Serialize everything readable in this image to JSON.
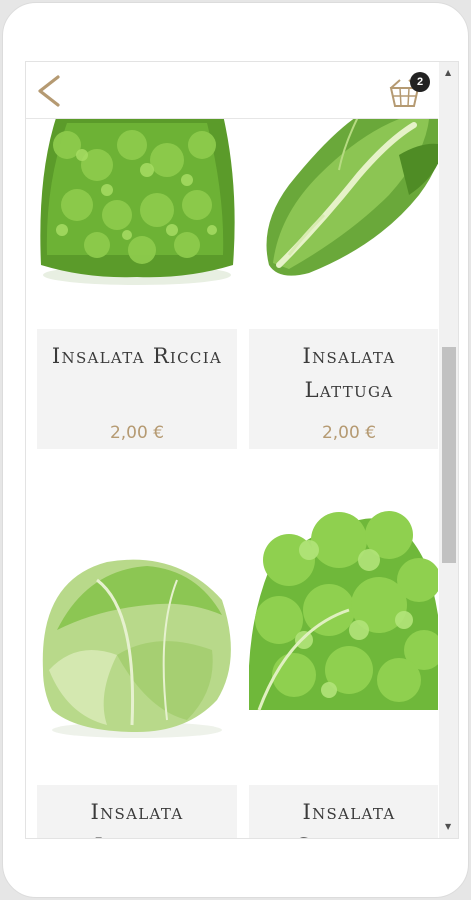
{
  "header": {
    "back_icon": "chevron-left-icon",
    "cart_icon": "shopping-basket-icon",
    "cart_count": "2",
    "accent_color": "#b59a72"
  },
  "products": [
    {
      "name": "Insalata Riccia",
      "price": "2,00 €",
      "image": "curly-lettuce"
    },
    {
      "name": "Insalata\nLattuga",
      "price": "2,00 €",
      "image": "romaine-lettuce"
    },
    {
      "name": "Insalata\nIceberg",
      "price": "",
      "image": "iceberg-lettuce"
    },
    {
      "name": "Insalata\nGentilina",
      "price": "",
      "image": "gentilina-lettuce"
    }
  ]
}
